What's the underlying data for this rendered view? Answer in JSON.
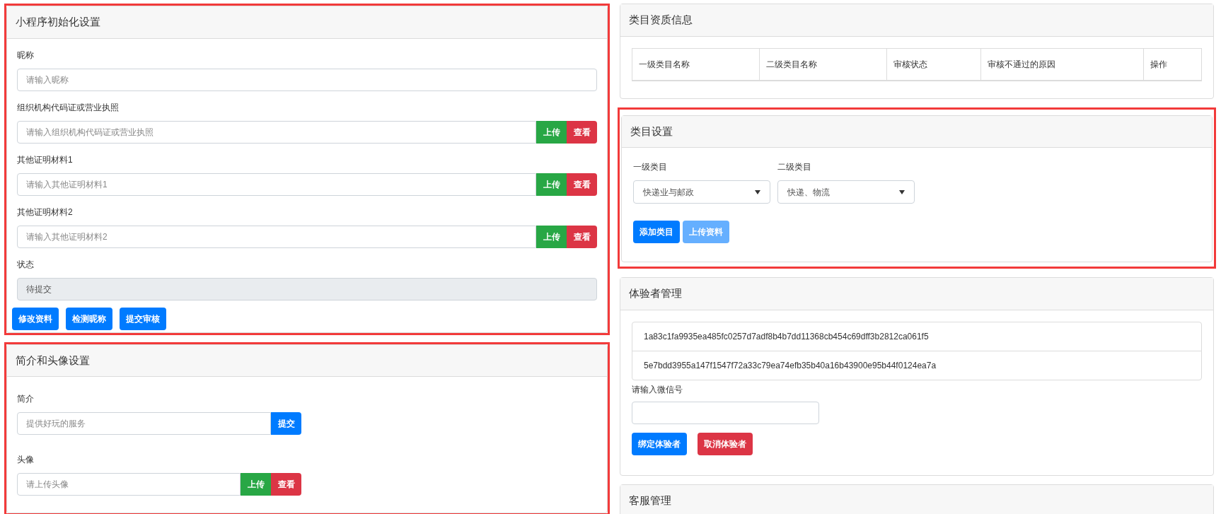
{
  "left": [
    {
      "title": "小程序初始化设置",
      "highlighted": true,
      "fields": [
        {
          "kind": "text",
          "label": "昵称",
          "placeholder": "请输入昵称"
        },
        {
          "kind": "group",
          "label": "组织机构代码证或营业执照",
          "placeholder": "请输入组织机构代码证或营业执照",
          "buttons": [
            {
              "label": "上传",
              "kind": "upload"
            },
            {
              "label": "查看",
              "kind": "view"
            }
          ]
        },
        {
          "kind": "group",
          "label": "其他证明材料1",
          "placeholder": "请输入其他证明材料1",
          "buttons": [
            {
              "label": "上传",
              "kind": "upload"
            },
            {
              "label": "查看",
              "kind": "view"
            }
          ]
        },
        {
          "kind": "group",
          "label": "其他证明材料2",
          "placeholder": "请输入其他证明材料2",
          "buttons": [
            {
              "label": "上传",
              "kind": "upload"
            },
            {
              "label": "查看",
              "kind": "view"
            }
          ]
        },
        {
          "kind": "readonly",
          "label": "状态",
          "value": "待提交"
        }
      ],
      "buttons": [
        {
          "label": "修改资料"
        },
        {
          "label": "检测昵称"
        },
        {
          "label": "提交审核"
        }
      ]
    },
    {
      "title": "简介和头像设置",
      "highlighted": true,
      "fields": [
        {
          "kind": "group",
          "label": "简介",
          "placeholder": "提供好玩的服务",
          "buttons": [
            {
              "label": "提交",
              "kind": "action"
            }
          ]
        },
        {
          "kind": "group",
          "label": "头像",
          "placeholder": "请上传头像",
          "buttons": [
            {
              "label": "上传",
              "kind": "upload"
            },
            {
              "label": "查看",
              "kind": "view"
            }
          ]
        }
      ]
    }
  ],
  "qualification": {
    "title": "类目资质信息",
    "highlighted": false,
    "columns": [
      "一级类目名称",
      "二级类目名称",
      "审核状态",
      "审核不通过的原因",
      "操作"
    ]
  },
  "category": {
    "title": "类目设置",
    "highlighted": true,
    "selects": [
      {
        "label": "一级类目",
        "value": "快递业与邮政"
      },
      {
        "label": "二级类目",
        "value": "快递、物流"
      }
    ],
    "buttons": [
      {
        "label": "添加类目",
        "disabled": false
      },
      {
        "label": "上传资料",
        "disabled": true
      }
    ]
  },
  "testers": {
    "title": "体验者管理",
    "highlighted": false,
    "ids": [
      "1a83c1fa9935ea485fc0257d7adf8b4b7dd11368cb454c69dff3b2812ca061f5",
      "5e7bdd3955a147f1547f72a33c79ea74efb35b40a16b43900e95b44f0124ea7a"
    ],
    "field_label": "请输入微信号",
    "buttons": [
      {
        "label": "绑定体验者",
        "kind": "action"
      },
      {
        "label": "取消体验者",
        "kind": "cancel"
      }
    ]
  },
  "service": {
    "title": "客服管理",
    "highlighted": false
  }
}
